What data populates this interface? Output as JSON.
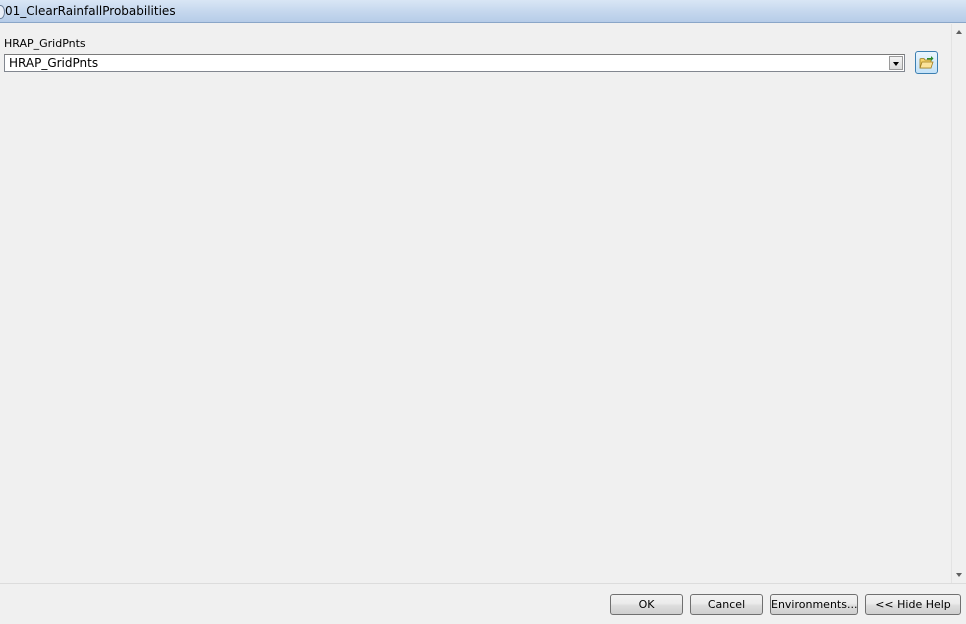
{
  "window": {
    "title": "01_ClearRainfallProbabilities"
  },
  "form": {
    "param_label": "HRAP_GridPnts",
    "param_value": "HRAP_GridPnts"
  },
  "icons": {
    "browse": "open-folder-icon",
    "dropdown": "chevron-down-icon"
  },
  "buttons": {
    "ok": "OK",
    "cancel": "Cancel",
    "environments": "Environments...",
    "hide_help": "<< Hide Help"
  },
  "colors": {
    "titlebar": "#c6d8ee",
    "background": "#f0f0f0",
    "browse_accent": "#3c7fb1"
  }
}
